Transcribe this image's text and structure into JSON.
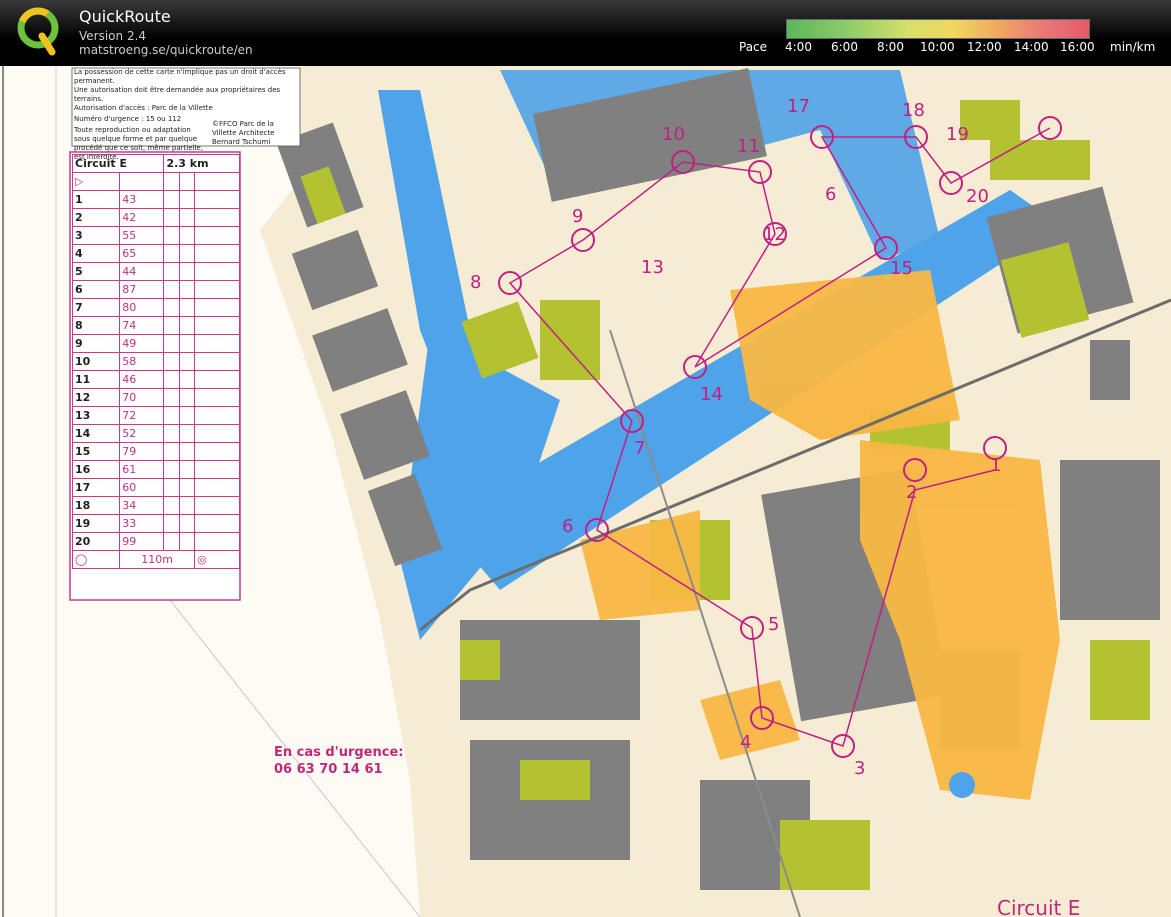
{
  "app": {
    "name": "QuickRoute",
    "version": "Version 2.4",
    "url": "matstroeng.se/quickroute/en"
  },
  "pace": {
    "label": "Pace",
    "unit": "min/km",
    "ticks": [
      "4:00",
      "6:00",
      "8:00",
      "10:00",
      "12:00",
      "14:00",
      "16:00"
    ]
  },
  "map": {
    "notes": {
      "line1": "La possession de cette carte n'implique pas un droit d'accès permanent.",
      "line2": "Une autorisation doit être demandée aux propriétaires des terrains.",
      "line3": "Autorisation d'accès : Parc de la Villette",
      "line4": "Numéro d'urgence : 15 ou 112",
      "line5": "Toute reproduction ou adaptation sous quelque forme et par quelque procédé que ce soit, même partielle, est interdite.",
      "line6": "©FFCO Parc de la Villette Architecte Bernard Tschumi"
    },
    "legend": {
      "title": "Circuit E",
      "distance": "2.3 km",
      "rows": [
        {
          "n": "1",
          "code": "43"
        },
        {
          "n": "2",
          "code": "42"
        },
        {
          "n": "3",
          "code": "55"
        },
        {
          "n": "4",
          "code": "65"
        },
        {
          "n": "5",
          "code": "44"
        },
        {
          "n": "6",
          "code": "87"
        },
        {
          "n": "7",
          "code": "80"
        },
        {
          "n": "8",
          "code": "74"
        },
        {
          "n": "9",
          "code": "49"
        },
        {
          "n": "10",
          "code": "58"
        },
        {
          "n": "11",
          "code": "46"
        },
        {
          "n": "12",
          "code": "70"
        },
        {
          "n": "13",
          "code": "72"
        },
        {
          "n": "14",
          "code": "52"
        },
        {
          "n": "15",
          "code": "79"
        },
        {
          "n": "16",
          "code": "61"
        },
        {
          "n": "17",
          "code": "60"
        },
        {
          "n": "18",
          "code": "34"
        },
        {
          "n": "19",
          "code": "33"
        },
        {
          "n": "20",
          "code": "99"
        }
      ],
      "finish": "110m"
    },
    "urgency_title": "En cas d'urgence:",
    "urgency_phone": "06 63 70 14 61",
    "circuit_footer": "Circuit E",
    "controls": [
      {
        "label": "1"
      },
      {
        "label": "2"
      },
      {
        "label": "3"
      },
      {
        "label": "4"
      },
      {
        "label": "5"
      },
      {
        "label": "6"
      },
      {
        "label": "7"
      },
      {
        "label": "8"
      },
      {
        "label": "9"
      },
      {
        "label": "10"
      },
      {
        "label": "11"
      },
      {
        "label": "12"
      },
      {
        "label": "13"
      },
      {
        "label": "14"
      },
      {
        "label": "15"
      },
      {
        "label": "6"
      },
      {
        "label": "17"
      },
      {
        "label": "18"
      },
      {
        "label": "19"
      },
      {
        "label": "20"
      }
    ]
  }
}
